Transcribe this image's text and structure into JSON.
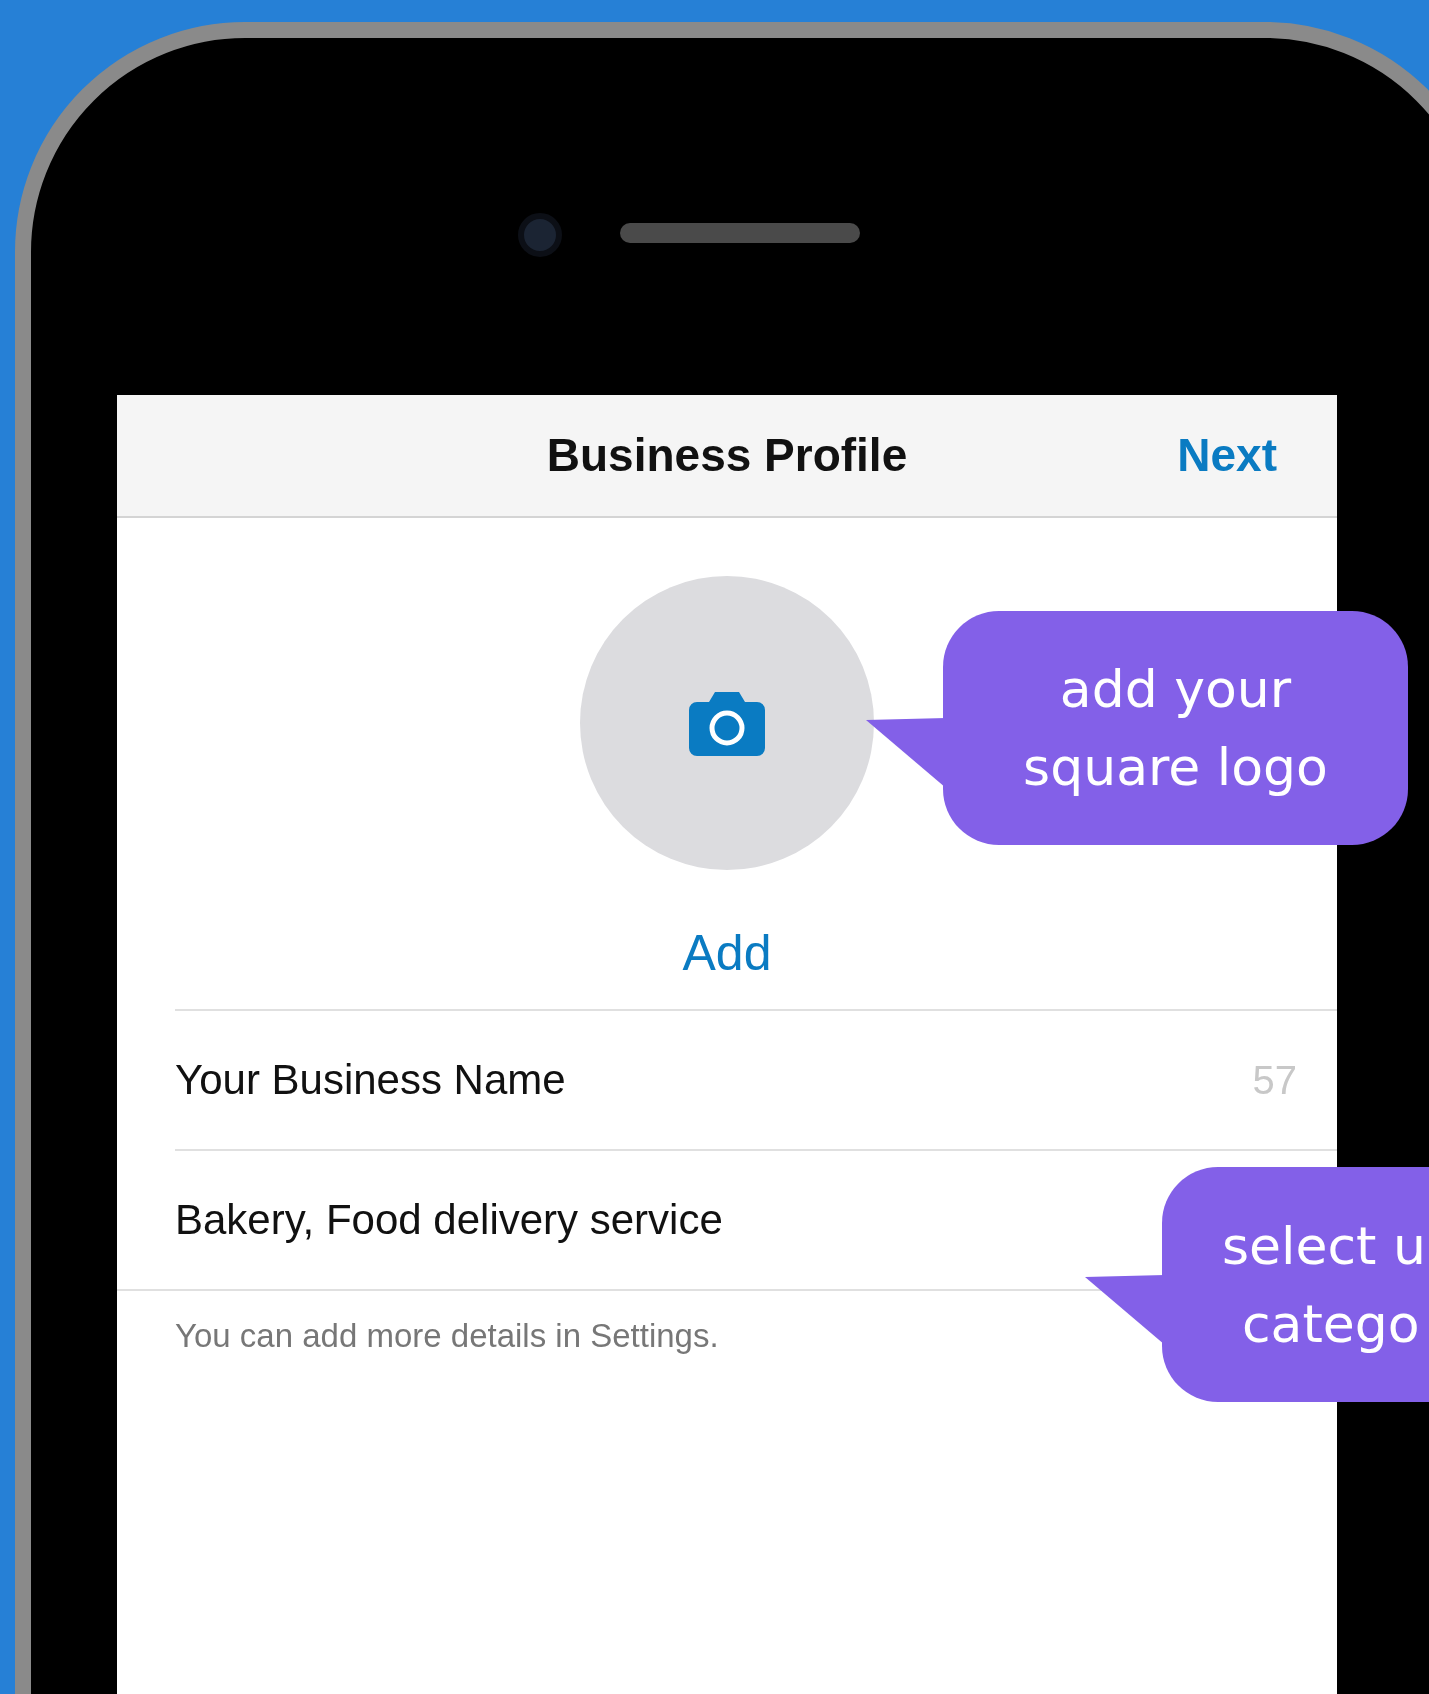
{
  "nav": {
    "title": "Business Profile",
    "action": "Next"
  },
  "photo": {
    "action": "Add"
  },
  "fields": [
    {
      "value": "Your Business Name",
      "counter": "57"
    },
    {
      "value": "Bakery, Food delivery service"
    }
  ],
  "footer": "You can add more details in Settings.",
  "callouts": [
    {
      "lines": [
        "add your",
        "square logo"
      ]
    },
    {
      "lines": [
        "select u",
        "catego"
      ]
    }
  ]
}
